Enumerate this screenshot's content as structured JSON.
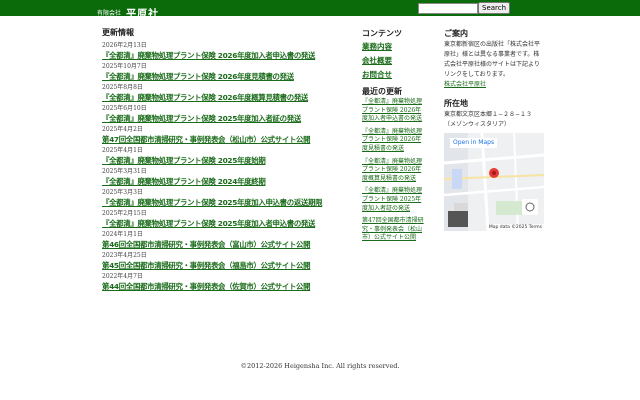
{
  "header": {
    "company_prefix": "有限会社",
    "company_name": "平原社",
    "search_button": "Search"
  },
  "main": {
    "title": "更新情報",
    "entries": [
      {
        "date": "2026年2月13日",
        "title": "『全都清』廃棄物処理プラント保険 2026年度加入者申込書の発送"
      },
      {
        "date": "2025年10月7日",
        "title": "『全都清』廃棄物処理プラント保険 2026年度見積書の発送"
      },
      {
        "date": "2025年8月8日",
        "title": "『全都清』廃棄物処理プラント保険 2026年度概算見積書の発送"
      },
      {
        "date": "2025年6月10日",
        "title": "『全都清』廃棄物処理プラント保険 2025年度加入者証の発送"
      },
      {
        "date": "2025年4月2日",
        "title": "第47回全国都市清掃研究・事例発表会（松山市）公式サイト公開"
      },
      {
        "date": "2025年4月1日",
        "title": "『全都清』廃棄物処理プラント保険 2025年度始期"
      },
      {
        "date": "2025年3月31日",
        "title": "『全都清』廃棄物処理プラント保険 2024年度終期"
      },
      {
        "date": "2025年3月3日",
        "title": "『全都清』廃棄物処理プラント保険 2025年度加入申込書の返送期限"
      },
      {
        "date": "2025年2月15日",
        "title": "『全都清』廃棄物処理プラント保険 2025年度加入者申込書の発送"
      },
      {
        "date": "2024年1月1日",
        "title": "第46回全国都市清掃研究・事例発表会（富山市）公式サイト公開"
      },
      {
        "date": "2023年4月25日",
        "title": "第45回全国都市清掃研究・事例発表会（福島市）公式サイト公開"
      },
      {
        "date": "2022年4月7日",
        "title": "第44回全国都市清掃研究・事例発表会（佐賀市）公式サイト公開"
      }
    ]
  },
  "contents": {
    "title": "コンテンツ",
    "items": [
      "業務内容",
      "会社概要",
      "お問合せ"
    ]
  },
  "recent": {
    "title": "最近の更新",
    "items": [
      "『全都清』廃棄物処理プラント保険 2026年度加入者申込書の発送",
      "『全都清』廃棄物処理プラント保険 2026年度見積書の発送",
      "『全都清』廃棄物処理プラント保険 2026年度概算見積書の発送",
      "『全都清』廃棄物処理プラント保険 2025年度加入者証の発送",
      "第47回全国都市清掃研究・事例発表会（松山市）公式サイト公開"
    ]
  },
  "guide": {
    "title": "ご案内",
    "text": "東京都新宿区の出版社「株式会社平原社」様とは異なる事業者です。株式会社平原社様のサイトは下記よりリンクをしております。",
    "link": "株式会社平原社"
  },
  "location": {
    "title": "所在地",
    "address1": "東京都文京区本郷１−２８−１３",
    "address2": "（メゾンウィスタリア）",
    "open_maps": "Open in Maps",
    "map_data": "Map data ©2025  Terms"
  },
  "footer": {
    "copyright": "©2012-2026 Heigensha Inc. All rights reserved."
  }
}
